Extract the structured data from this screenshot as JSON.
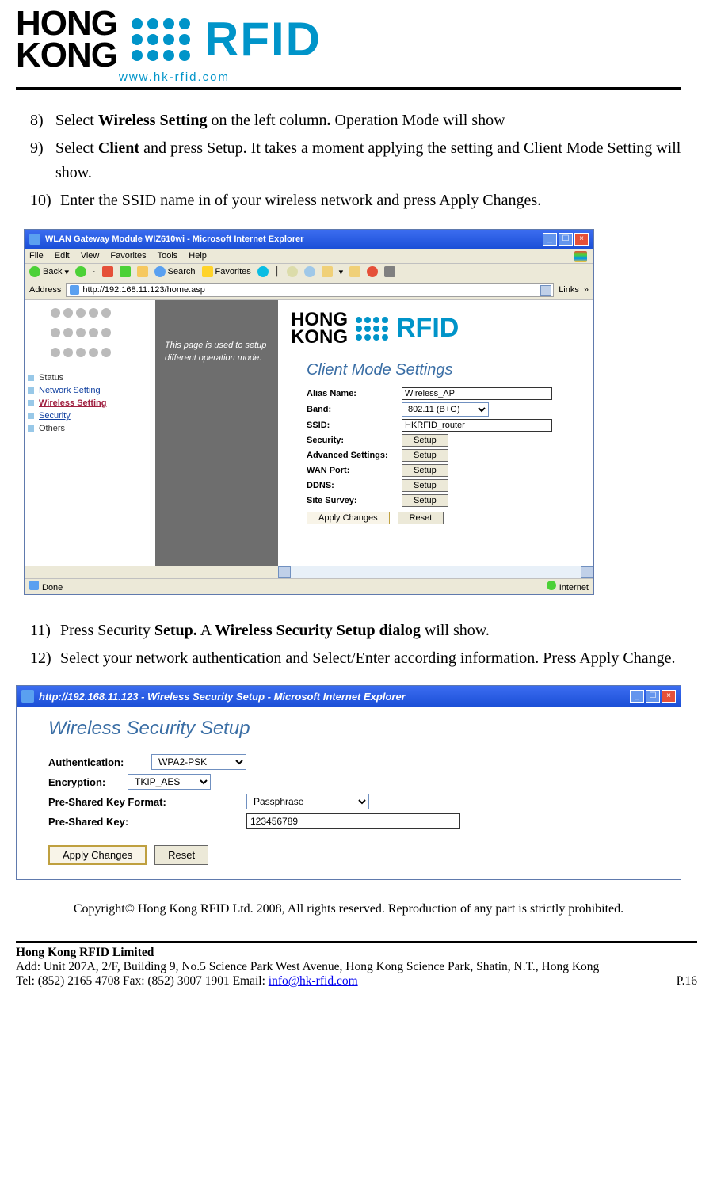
{
  "header": {
    "logo_hk_l1": "HONG",
    "logo_hk_l2": "KONG",
    "logo_rfid": "RFID",
    "url": "www.hk-rfid.com"
  },
  "body": {
    "item8": {
      "num": "8)",
      "pre": "Select ",
      "bold": "Wireless Setting",
      "mid": " on the left column",
      "dot": ". ",
      "post": "Operation Mode will show"
    },
    "item9": {
      "num": "9)",
      "pre": "Select ",
      "bold": "Client",
      "post": " and press Setup. It takes a moment applying the setting and Client Mode Setting will show."
    },
    "item10": {
      "num": "10)",
      "text": "Enter the SSID name in of your wireless network and press Apply Changes."
    },
    "item11": {
      "num": "11)",
      "pre": " Press Security ",
      "b1": "Setup.",
      "mid": " A ",
      "b2": "Wireless Security Setup dialog",
      "post": " will show."
    },
    "item12": {
      "num": "12)",
      "text": " Select your network authentication and Select/Enter according information. Press Apply Change."
    }
  },
  "shot1": {
    "title": "WLAN Gateway Module WIZ610wi - Microsoft Internet Explorer",
    "menu": [
      "File",
      "Edit",
      "View",
      "Favorites",
      "Tools",
      "Help"
    ],
    "toolbar": {
      "back": "Back",
      "search": "Search",
      "favorites": "Favorites"
    },
    "address_label": "Address",
    "address_url": "http://192.168.11.123/home.asp",
    "links": "Links",
    "nav": {
      "status": "Status",
      "network": "Network Setting",
      "wireless": "Wireless Setting",
      "security": "Security",
      "others": "Others"
    },
    "side_desc": "This page is used to setup different operation mode.",
    "panel_header": "Client Mode Settings",
    "form": {
      "alias_lbl": "Alias Name:",
      "alias_val": "Wireless_AP",
      "band_lbl": "Band:",
      "band_val": "802.11 (B+G)",
      "ssid_lbl": "SSID:",
      "ssid_val": "HKRFID_router",
      "security_lbl": "Security:",
      "adv_lbl": "Advanced Settings:",
      "wan_lbl": "WAN Port:",
      "ddns_lbl": "DDNS:",
      "survey_lbl": "Site Survey:",
      "setup_btn": "Setup",
      "apply_btn": "Apply Changes",
      "reset_btn": "Reset"
    },
    "status_done": "Done",
    "status_internet": "Internet"
  },
  "shot2": {
    "title": "http://192.168.11.123 - Wireless Security Setup - Microsoft Internet Explorer",
    "heading": "Wireless Security Setup",
    "auth_lbl": "Authentication:",
    "auth_val": "WPA2-PSK",
    "enc_lbl": "Encryption:",
    "enc_val": "TKIP_AES",
    "pskf_lbl": "Pre-Shared Key Format:",
    "pskf_val": "Passphrase",
    "psk_lbl": "Pre-Shared Key:",
    "psk_val": "123456789",
    "apply_btn": "Apply Changes",
    "reset_btn": "Reset"
  },
  "copyright": "Copyright© Hong Kong RFID Ltd. 2008, All rights reserved. Reproduction of any part is strictly prohibited.",
  "footer": {
    "company": "Hong Kong RFID Limited",
    "addr": "Add: Unit 207A, 2/F, Building 9, No.5 Science Park West Avenue, Hong Kong Science Park, Shatin, N.T., Hong Kong",
    "tel_pre": "Tel: (852) 2165 4708   Fax: (852) 3007 1901   Email: ",
    "email": "info@hk-rfid.com",
    "page": "P.16"
  }
}
